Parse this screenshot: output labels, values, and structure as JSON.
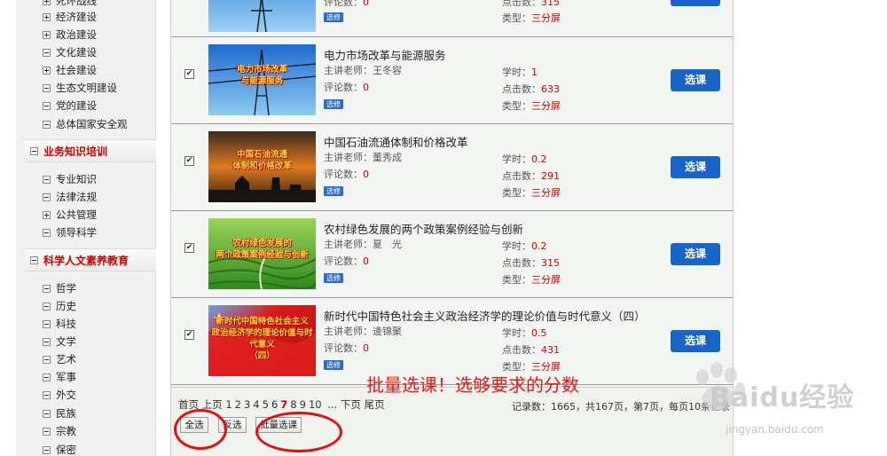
{
  "sidebar": {
    "top_items": [
      {
        "label": "死环战线",
        "icon": "plus"
      },
      {
        "label": "经济建设",
        "icon": "plus"
      },
      {
        "label": "政治建设",
        "icon": "plus"
      },
      {
        "label": "文化建设",
        "icon": "minus"
      },
      {
        "label": "社会建设",
        "icon": "plus"
      },
      {
        "label": "生态文明建设",
        "icon": "minus"
      },
      {
        "label": "党的建设",
        "icon": "minus"
      },
      {
        "label": "总体国家安全观",
        "icon": "minus"
      }
    ],
    "category_business": "业务知识培训",
    "business_items": [
      {
        "label": "专业知识",
        "icon": "minus"
      },
      {
        "label": "法律法规",
        "icon": "minus"
      },
      {
        "label": "公共管理",
        "icon": "plus"
      },
      {
        "label": "领导科学",
        "icon": "minus"
      }
    ],
    "category_humanities": "科学人文素养教育",
    "humanities_items": [
      {
        "label": "哲学"
      },
      {
        "label": "历史"
      },
      {
        "label": "科技"
      },
      {
        "label": "文学"
      },
      {
        "label": "艺术"
      },
      {
        "label": "军事"
      },
      {
        "label": "外交"
      },
      {
        "label": "民族"
      },
      {
        "label": "宗教"
      },
      {
        "label": "保密"
      }
    ]
  },
  "labels": {
    "teacher": "主讲老师：",
    "comments": "评论数：",
    "hours": "学时：",
    "clicks": "点击数：",
    "type": "类型：",
    "tag": "选修",
    "select_button": "选课",
    "checked_mark": "✔"
  },
  "partial_row": {
    "comments_value": "0",
    "clicks_value": "315",
    "type_value": "三分屏"
  },
  "courses": [
    {
      "title": "电力市场改革与能源服务",
      "teacher": "王冬容",
      "comments": "0",
      "hours": "1",
      "clicks": "633",
      "type": "三分屏",
      "thumb_text": "电力市场改革\n与能源服务"
    },
    {
      "title": "中国石油流通体制和价格改革",
      "teacher": "董秀成",
      "comments": "0",
      "hours": "0.2",
      "clicks": "291",
      "type": "三分屏",
      "thumb_text": "中国石油流通\n体制和价格改革"
    },
    {
      "title": "农村绿色发展的两个政策案例经验与创新",
      "teacher": "夏　光",
      "comments": "0",
      "hours": "0.2",
      "clicks": "315",
      "type": "三分屏",
      "thumb_text": "农村绿色发展的\n两个政策案例经验与创新"
    },
    {
      "title": "新时代中国特色社会主义政治经济学的理论价值与时代意义（四）",
      "teacher": "逄锦聚",
      "comments": "0",
      "hours": "0.5",
      "clicks": "431",
      "type": "三分屏",
      "thumb_text": "新时代中国特色社会主义\n政治经济学的理论价值与时代意义\n（四）"
    }
  ],
  "pager": {
    "first": "首页",
    "prev": "上页",
    "pages": [
      "1",
      "2",
      "3",
      "4",
      "5",
      "6"
    ],
    "current": "7",
    "pages_after": [
      "8",
      "9",
      "10"
    ],
    "ellipsis": "...",
    "next": "下页",
    "last": "尾页",
    "record_info": "记录数：1665，共167页，第7页，每页10条记录"
  },
  "buttons": {
    "select_all": "全选",
    "invert": "反选",
    "batch": "批量选课"
  },
  "annotation": "批量选课！选够要求的分数",
  "watermark": {
    "brand": "Baidu经验",
    "url": "jingyan.baidu.com"
  },
  "colors": {
    "accent_red": "#cc0000",
    "button_blue": "#1a64c8",
    "annotation_red": "#e81818"
  }
}
